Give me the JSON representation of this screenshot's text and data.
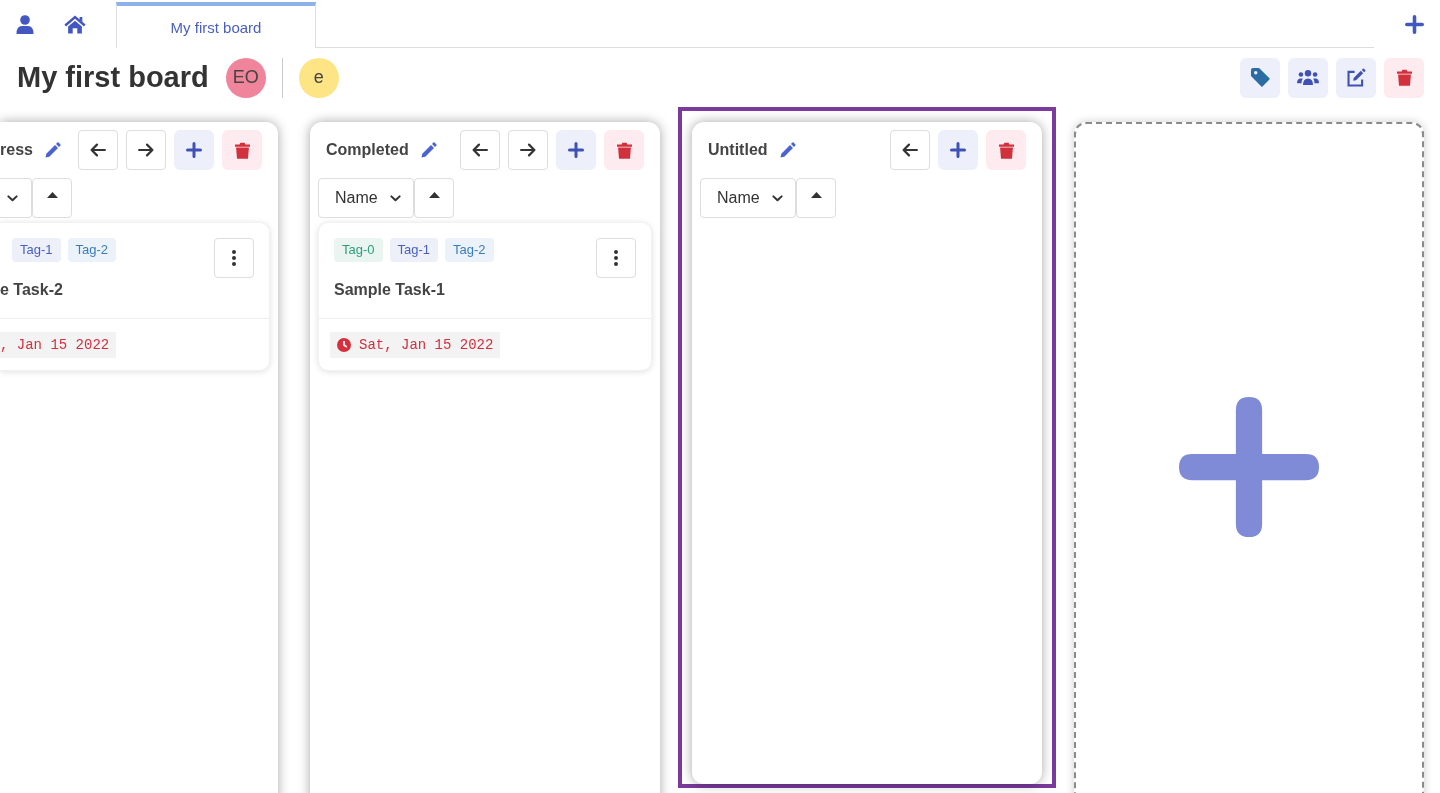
{
  "nav": {
    "tabs": [
      {
        "label": "My first board",
        "selected": true
      }
    ]
  },
  "board": {
    "title": "My first board",
    "owner": {
      "initials": "EO",
      "color": "#f0849a"
    },
    "members": [
      {
        "initials": "e",
        "color": "#fde585"
      }
    ],
    "actions": [
      {
        "kind": "tags"
      },
      {
        "kind": "members"
      },
      {
        "kind": "edit"
      },
      {
        "kind": "delete"
      }
    ]
  },
  "columns": [
    {
      "kind": "clipped",
      "title": "ress",
      "highlighted": false,
      "actions": [
        {
          "kind": "back"
        },
        {
          "kind": "forward"
        },
        {
          "kind": "add"
        },
        {
          "kind": "delete"
        }
      ],
      "tasks": [
        {
          "tags": [
            {
              "label": "Tag-1",
              "color": "#4a5fc1"
            },
            {
              "label": "Tag-2",
              "color": "#3a7bbf"
            }
          ],
          "title": "e Task-2",
          "due": ", Jan 15 2022"
        }
      ]
    },
    {
      "kind": "full",
      "title": "Completed",
      "highlighted": false,
      "sort_label": "Name",
      "actions": [
        {
          "kind": "back"
        },
        {
          "kind": "forward"
        },
        {
          "kind": "add"
        },
        {
          "kind": "delete"
        }
      ],
      "tasks": [
        {
          "tags": [
            {
              "label": "Tag-0",
              "color": "#2a9d7c"
            },
            {
              "label": "Tag-1",
              "color": "#4a5fc1"
            },
            {
              "label": "Tag-2",
              "color": "#3a7bbf"
            }
          ],
          "title": "Sample Task-1",
          "due": "Sat, Jan 15 2022"
        }
      ]
    },
    {
      "kind": "full",
      "title": "Untitled",
      "highlighted": true,
      "sort_label": "Name",
      "actions": [
        {
          "kind": "back"
        },
        {
          "kind": "add"
        },
        {
          "kind": "delete"
        }
      ]
    }
  ]
}
